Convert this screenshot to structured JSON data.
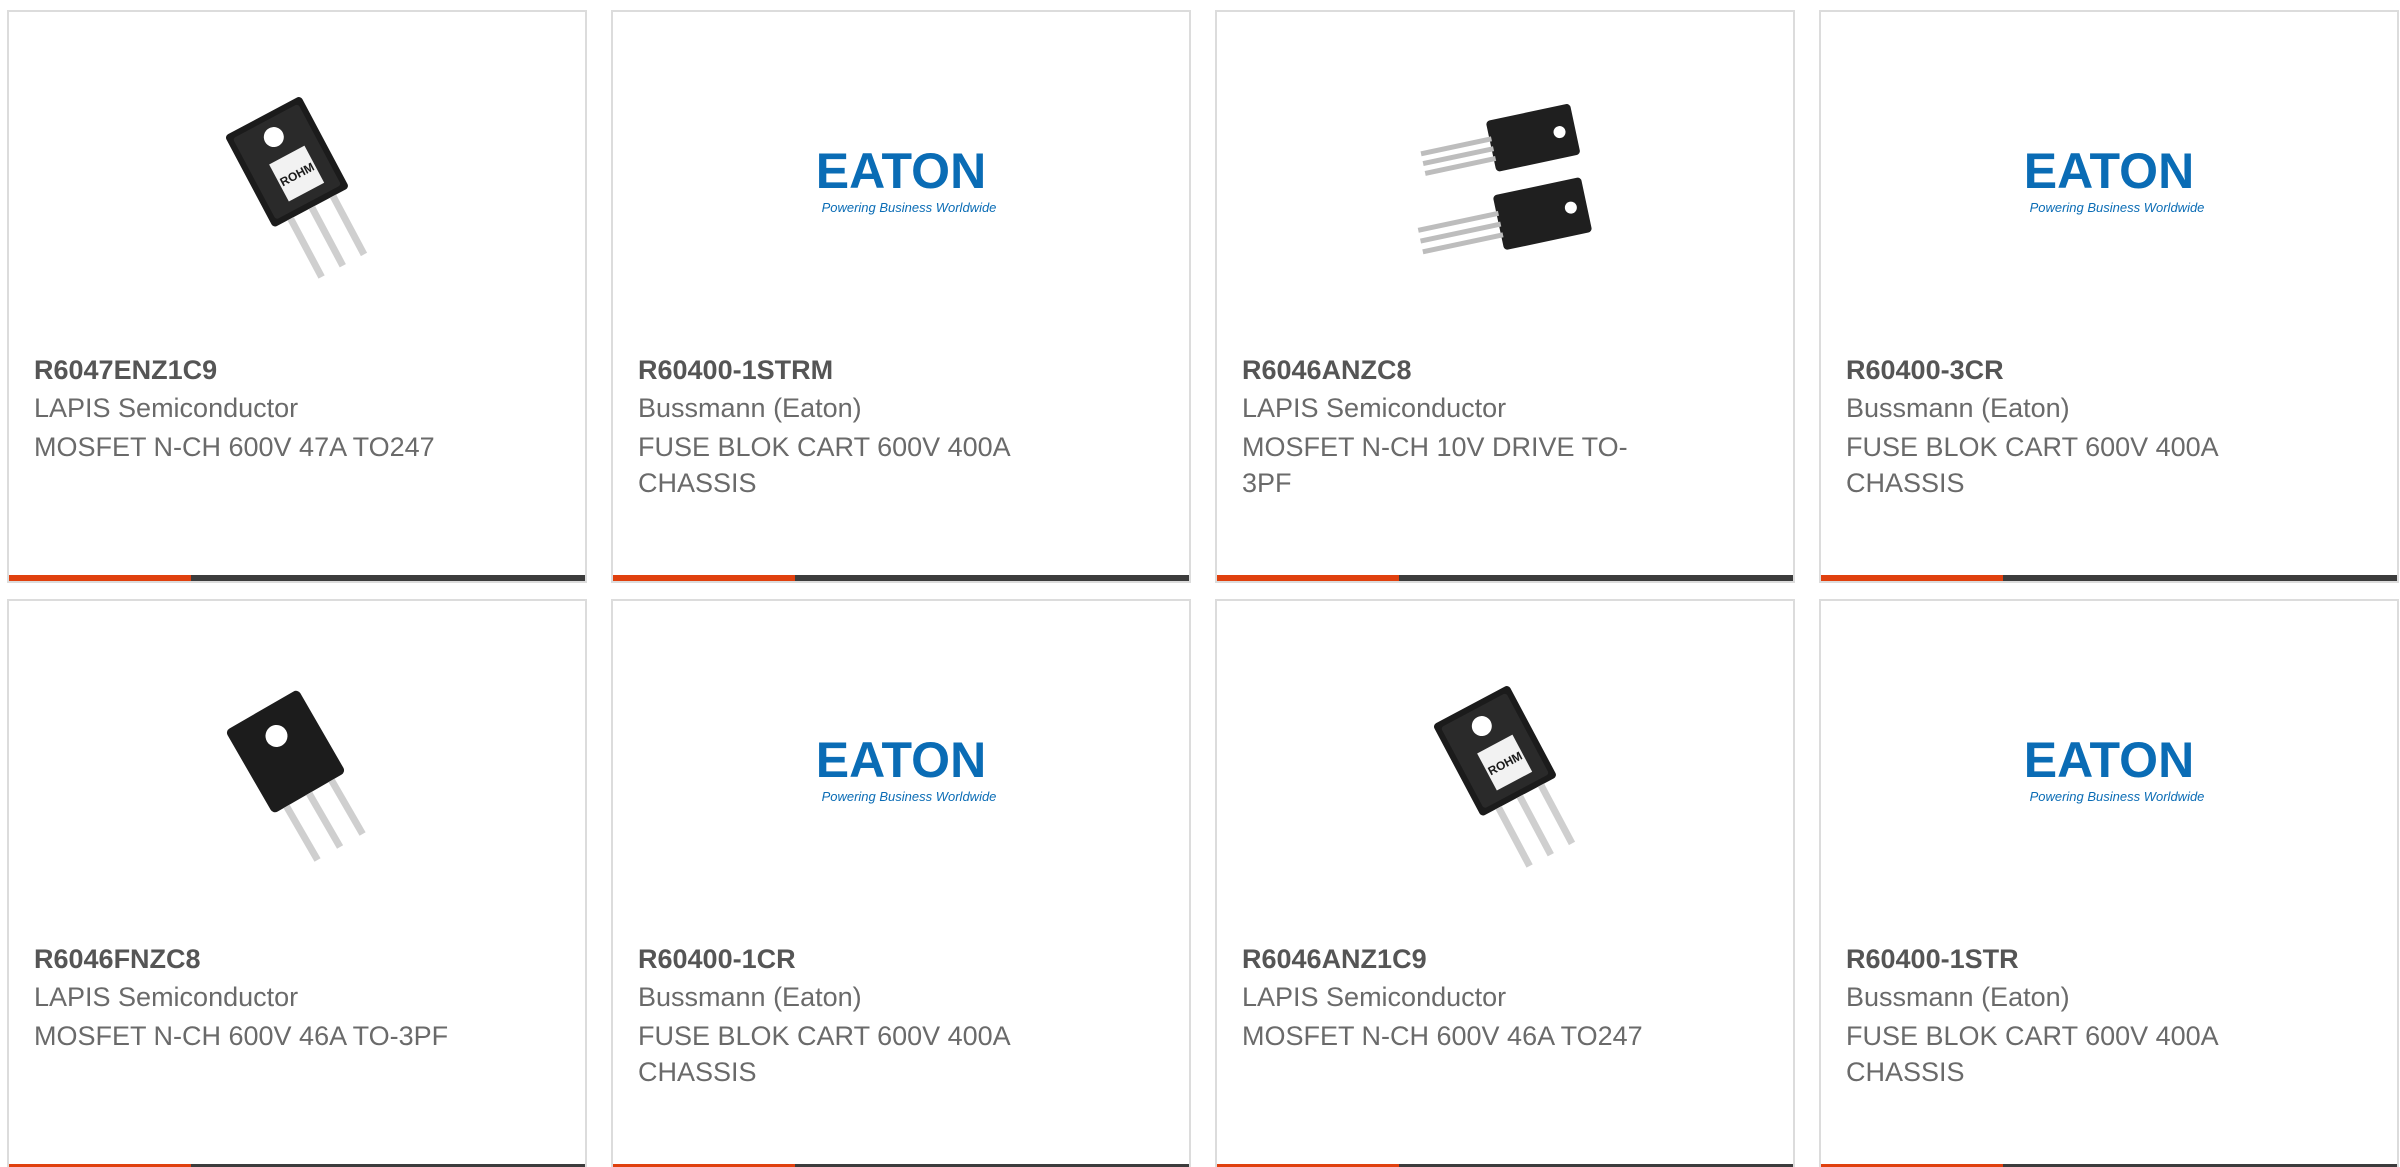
{
  "colors": {
    "accent": "#e0400e",
    "bar_dark": "#3c3c3c",
    "eaton_blue": "#0a6cb5"
  },
  "logo": {
    "eaton_word": "EATON",
    "eaton_tagline": "Powering Business Worldwide",
    "rohm_mark": "ROHM"
  },
  "products": [
    {
      "part_number": "R6047ENZ1C9",
      "manufacturer": "LAPIS Semiconductor",
      "description": "MOSFET N-CH 600V 47A TO247",
      "image": "to247-transistor-icon"
    },
    {
      "part_number": "R60400-1STRM",
      "manufacturer": "Bussmann (Eaton)",
      "description": "FUSE BLOK CART 600V 400A CHASSIS",
      "image": "eaton-logo"
    },
    {
      "part_number": "R6046ANZC8",
      "manufacturer": "LAPIS Semiconductor",
      "description": "MOSFET N-CH 10V DRIVE TO-3PF",
      "image": "to3pf-pair-icon"
    },
    {
      "part_number": "R60400-3CR",
      "manufacturer": "Bussmann (Eaton)",
      "description": "FUSE BLOK CART 600V 400A CHASSIS",
      "image": "eaton-logo"
    },
    {
      "part_number": "R6046FNZC8",
      "manufacturer": "LAPIS Semiconductor",
      "description": "MOSFET N-CH 600V 46A TO-3PF",
      "image": "to3pf-transistor-icon"
    },
    {
      "part_number": "R60400-1CR",
      "manufacturer": "Bussmann (Eaton)",
      "description": "FUSE BLOK CART 600V 400A CHASSIS",
      "image": "eaton-logo"
    },
    {
      "part_number": "R6046ANZ1C9",
      "manufacturer": "LAPIS Semiconductor",
      "description": "MOSFET N-CH 600V 46A TO247",
      "image": "to247-transistor-icon"
    },
    {
      "part_number": "R60400-1STR",
      "manufacturer": "Bussmann (Eaton)",
      "description": "FUSE BLOK CART 600V 400A CHASSIS",
      "image": "eaton-logo"
    }
  ]
}
